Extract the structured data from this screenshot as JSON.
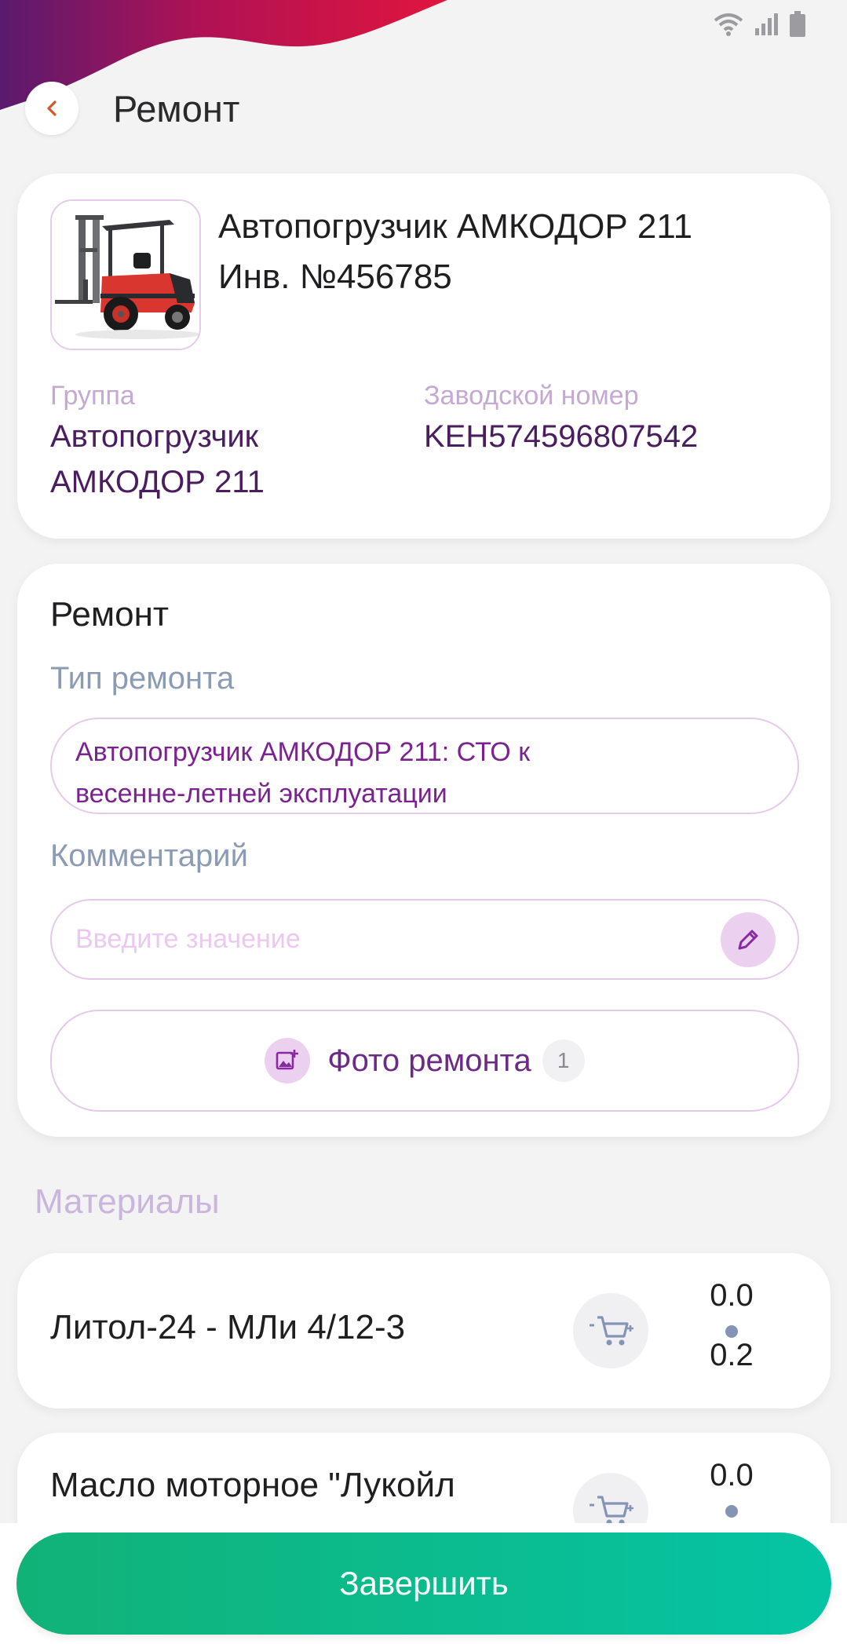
{
  "header": {
    "title": "Ремонт"
  },
  "equipment": {
    "title_line1": "Автопогрузчик АМКОДОР 211",
    "title_line2": "Инв. №456785",
    "group_label": "Группа",
    "group_value_line1": "Автопогрузчик",
    "group_value_line2": "АМКОДОР 211",
    "serial_label": "Заводской номер",
    "serial_value": "KEH574596807542"
  },
  "repair": {
    "section_title": "Ремонт",
    "type_label": "Тип ремонта",
    "type_value_line1": "Автопогрузчик АМКОДОР 211: СТО к",
    "type_value_line2": "весенне-летней эксплуатации",
    "comment_label": "Комментарий",
    "comment_placeholder": "Введите значение",
    "photo_label": "Фото ремонта",
    "photo_count": "1"
  },
  "materials": {
    "title": "Материалы",
    "items": [
      {
        "name": "Литол-24 - МЛи 4/12-3",
        "qty_top": "0.0",
        "qty_bottom": "0.2"
      },
      {
        "name": "Масло моторное \"Лукойл",
        "qty_top": "0.0"
      }
    ]
  },
  "footer": {
    "finish_label": "Завершить"
  },
  "colors": {
    "accent_purple": "#7b2291",
    "finish_green": "#11b277",
    "wave_start": "#6c1f6b",
    "wave_end": "#e0153e"
  },
  "icons": [
    "back-chevron-icon",
    "wifi-icon",
    "signal-icon",
    "battery-icon",
    "pencil-icon",
    "add-photo-icon",
    "cart-icon"
  ]
}
